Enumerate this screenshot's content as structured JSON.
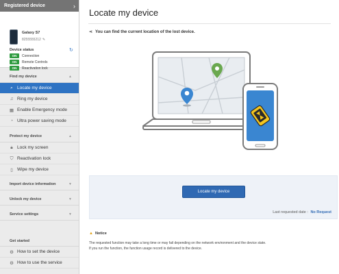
{
  "sidebar": {
    "registered_label": "Registered device",
    "device_name": "Galaxy S7",
    "device_number": "8255555212",
    "status_label": "Device status",
    "statuses": [
      {
        "badge": "ON",
        "label": "Connection"
      },
      {
        "badge": "ON",
        "label": "Remote Controls"
      },
      {
        "badge": "ON",
        "label": "Reactivation lock"
      }
    ],
    "sections": {
      "find": {
        "label": "Find my device",
        "items": [
          "Locate my device",
          "Ring my device",
          "Enable Emergency mode",
          "Ultra power saving mode"
        ]
      },
      "protect": {
        "label": "Protect my device",
        "items": [
          "Lock my screen",
          "Reactivation lock",
          "Wipe my device"
        ]
      },
      "import": {
        "label": "Import device information"
      },
      "unlock": {
        "label": "Unlock my device"
      },
      "service": {
        "label": "Service settings"
      },
      "get_started": {
        "label": "Get started",
        "items": [
          "How to set the device",
          "How to use the service"
        ]
      }
    },
    "icons": {
      "chevron": "chevron-right-icon",
      "refresh": "refresh-icon",
      "locate": "search-icon",
      "ring": "music-note-icon",
      "emergency": "emergency-icon",
      "power": "power-saving-icon",
      "lock": "lock-icon",
      "reactivation": "shield-icon",
      "wipe": "trash-icon",
      "gear": "gear-icon"
    }
  },
  "main": {
    "title": "Locate my device",
    "intro": "You can find the current location of the lost device.",
    "button_label": "Locate my device",
    "last_requested_label": "Last requested date :",
    "last_requested_value": "No Request",
    "notice_title": "Notice",
    "notice_lines": [
      "The requested function may take a long time or may fail depending on the network environment and the device state.",
      "If you run the function, the function usage record is delivered to the device."
    ]
  },
  "colors": {
    "accent": "#2e73c3",
    "on_badge": "#2e9b3f",
    "header_bg": "#747474",
    "pin_blue": "#3a86d1",
    "pin_green": "#6aa84f",
    "phone_yellow": "#f4c61f"
  }
}
